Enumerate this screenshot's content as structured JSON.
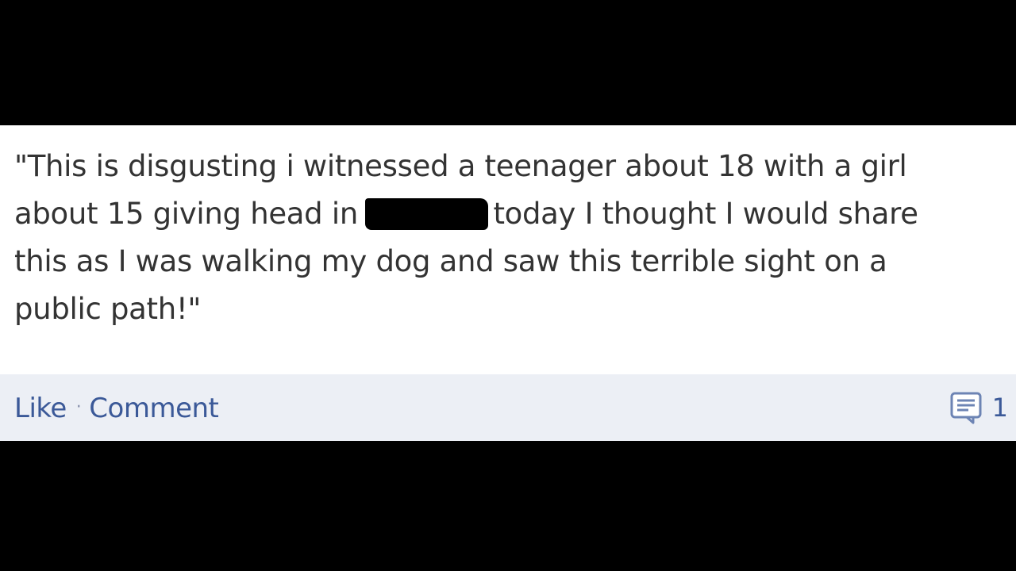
{
  "post": {
    "text_line_1": "\"This is disgusting i witnessed a teenager about 18 with a girl",
    "text_line_2_before": "about 15 giving head in",
    "text_line_2_after": "today I thought I would share",
    "text_line_3": "this as I was walking my dog and saw this terrible sight on a",
    "text_line_4": "public path!\""
  },
  "actions": {
    "like_label": "Like",
    "separator": "·",
    "comment_label": "Comment"
  },
  "comments": {
    "icon": "comment-bubble-icon",
    "count": "1"
  },
  "colors": {
    "link": "#3b5998",
    "action_bar_bg": "#eceff5",
    "text": "#333333"
  }
}
